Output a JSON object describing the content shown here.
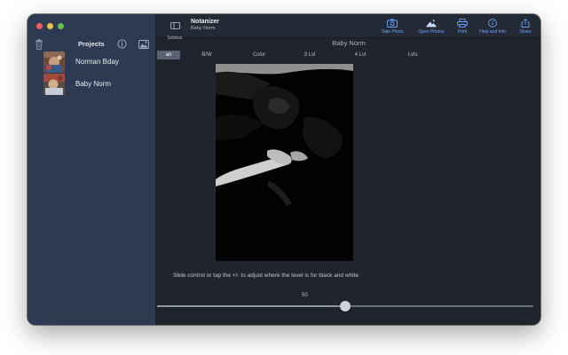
{
  "sidebar": {
    "title": "Projects",
    "items": [
      {
        "label": "Norman Bday"
      },
      {
        "label": "Baby Norm"
      }
    ]
  },
  "toolbar": {
    "sidebar_label": "Sidebar",
    "app_name": "Notanizer",
    "project_name": "Baby Norm",
    "buttons": [
      {
        "label": "Take Photo",
        "icon": "camera-icon"
      },
      {
        "label": "Open Photos",
        "icon": "photos-icon"
      },
      {
        "label": "Print",
        "icon": "printer-icon"
      },
      {
        "label": "Help and Info",
        "icon": "info-icon"
      },
      {
        "label": "Share",
        "icon": "share-icon"
      }
    ]
  },
  "document": {
    "title": "Baby Norm"
  },
  "modes": [
    {
      "label": "an",
      "active": true
    },
    {
      "label": "B/W",
      "active": false
    },
    {
      "label": "Color",
      "active": false
    },
    {
      "label": "3 Lvl",
      "active": false
    },
    {
      "label": "4 Lvl",
      "active": false
    },
    {
      "label": "Lvls",
      "active": false
    }
  ],
  "hint": "Slide control or tap the +/- to adjust where the level is for black and white",
  "slider": {
    "value": 50,
    "value_label": "50",
    "min": 0,
    "max": 100
  },
  "colors": {
    "sidebar": "#2e3a51",
    "main": "#20242d",
    "accent": "#6ea3ff"
  }
}
